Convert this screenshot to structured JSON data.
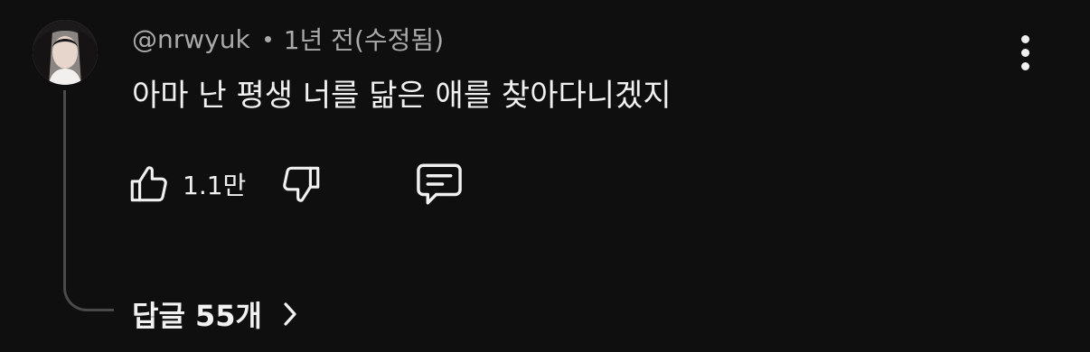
{
  "comment": {
    "author": "@nrwyuk",
    "separator": "•",
    "time": "1년 전(수정됨)",
    "text": "아마 난 평생 너를 닮은 애를 찾아다니겠지",
    "like_count": "1.1만",
    "replies_label": "답글 55개"
  },
  "icons": {
    "avatar": "avatar",
    "like": "thumbs-up-icon",
    "dislike": "thumbs-down-icon",
    "reply": "comment-icon",
    "menu": "more-vertical-icon",
    "chevron": "chevron-right-icon"
  },
  "colors": {
    "background": "#0f0f0f",
    "primary_text": "#f1f1f1",
    "secondary_text": "#aaaaaa",
    "thread_line": "#4a4a4a"
  }
}
